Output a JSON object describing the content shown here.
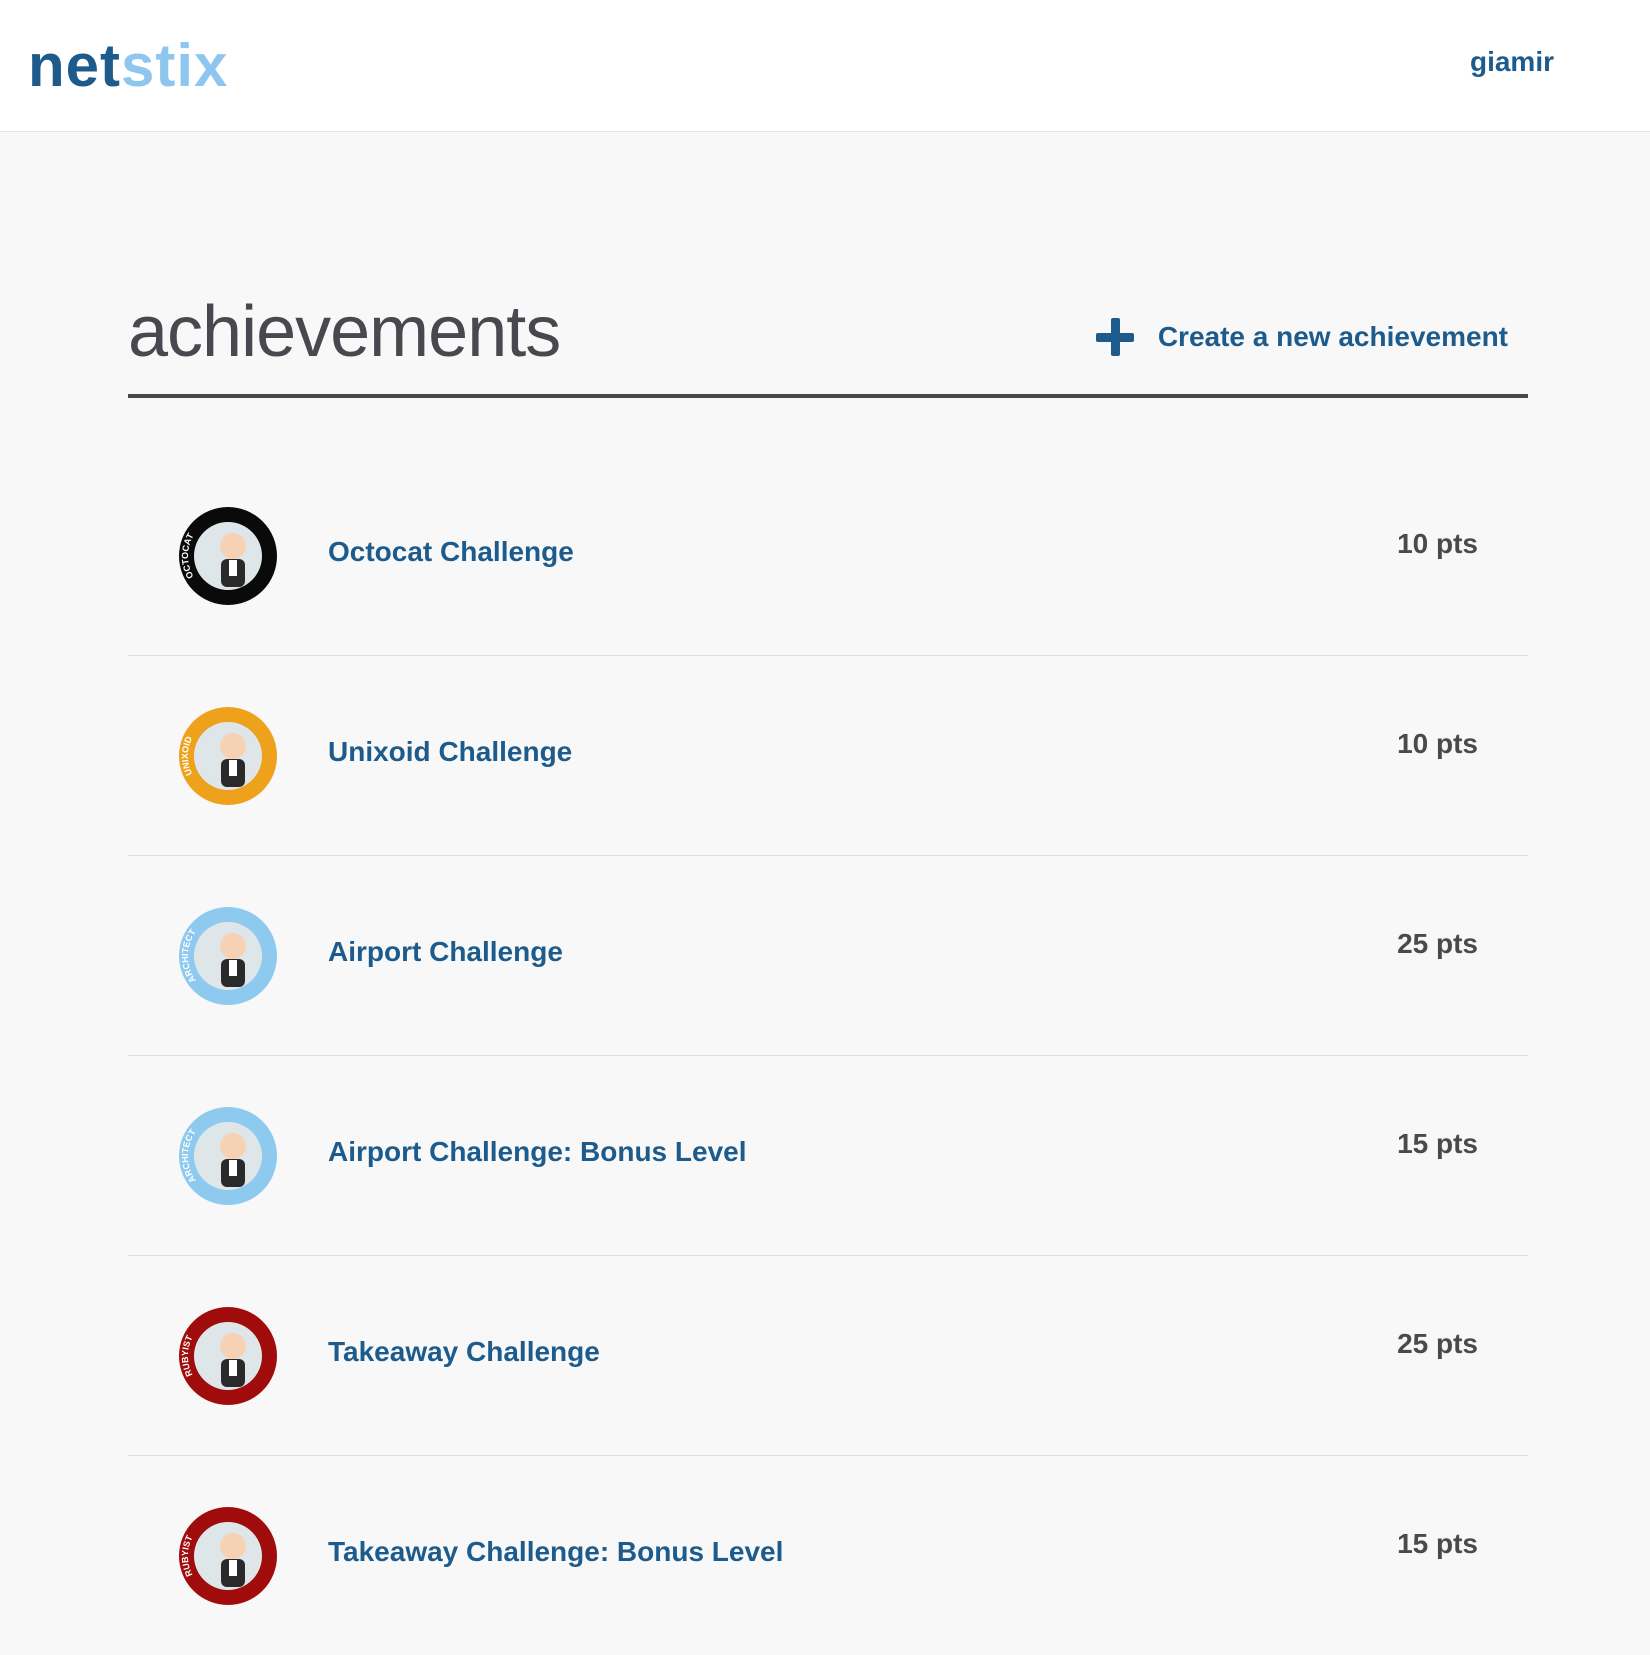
{
  "navbar": {
    "logo_part1": "net",
    "logo_part2": "stix",
    "username": "giamir"
  },
  "page": {
    "title": "achievements",
    "create_label": "Create a new achievement"
  },
  "achievements": [
    {
      "title": "Octocat Challenge",
      "points": "10 pts",
      "badge_text": "OCTOCAT",
      "badge_color": "#0a0a0a"
    },
    {
      "title": "Unixoid Challenge",
      "points": "10 pts",
      "badge_text": "UNIXOID",
      "badge_color": "#eea21b"
    },
    {
      "title": "Airport Challenge",
      "points": "25 pts",
      "badge_text": "ARCHITECT",
      "badge_color": "#8ec9ef"
    },
    {
      "title": "Airport Challenge: Bonus Level",
      "points": "15 pts",
      "badge_text": "ARCHITECT",
      "badge_color": "#8ec9ef"
    },
    {
      "title": "Takeaway Challenge",
      "points": "25 pts",
      "badge_text": "RUBYIST",
      "badge_color": "#a00c0c"
    },
    {
      "title": "Takeaway Challenge: Bonus Level",
      "points": "15 pts",
      "badge_text": "RUBYIST",
      "badge_color": "#a00c0c"
    }
  ],
  "colors": {
    "brand": "#1c5b8c",
    "brand_light": "#8ec6ef",
    "text_dark": "#47494e",
    "background": "#f8f8f8"
  }
}
